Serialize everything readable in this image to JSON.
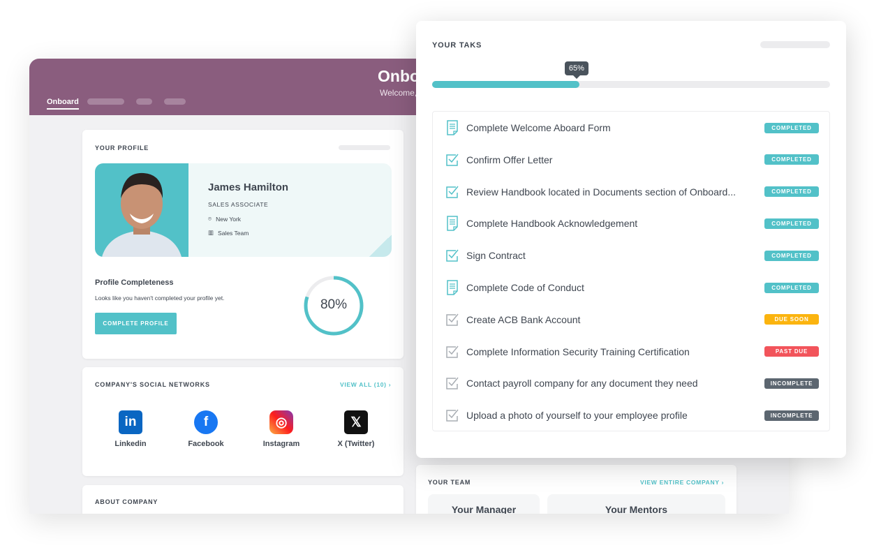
{
  "header": {
    "title": "Onboard",
    "subtitle": "Welcome,",
    "tabs": [
      {
        "label": "Onboard"
      }
    ]
  },
  "profile": {
    "section_title": "YOUR PROFILE",
    "name": "James Hamilton",
    "role": "SALES ASSOCIATE",
    "location": "New York",
    "team": "Sales Team",
    "completeness_title": "Profile Completeness",
    "completeness_text": "Looks like you haven't completed your profile yet.",
    "completeness_percent": "80%",
    "completeness_value": 80,
    "button": "COMPLETE PROFILE"
  },
  "social": {
    "section_title": "COMPANY'S SOCIAL NETWORKS",
    "view_all": "VIEW ALL (10)",
    "networks": [
      {
        "label": "Linkedin",
        "icon": "linkedin-icon",
        "color": "#0a66c2"
      },
      {
        "label": "Facebook",
        "icon": "facebook-icon",
        "color": "#1877f2"
      },
      {
        "label": "Instagram",
        "icon": "instagram-icon",
        "color": "#e1306c"
      },
      {
        "label": "X (Twitter)",
        "icon": "x-icon",
        "color": "#111111"
      }
    ]
  },
  "about": {
    "section_title": "ABOUT COMPANY"
  },
  "team": {
    "section_title": "YOUR TEAM",
    "view_link": "VIEW ENTIRE COMPANY",
    "manager": "Your Manager",
    "mentors": "Your Mentors"
  },
  "tasks": {
    "section_title": "YOUR TAKS",
    "progress_label": "65%",
    "progress_value": 37,
    "items": [
      {
        "label": "Complete Welcome Aboard Form",
        "icon": "document",
        "status": "COMPLETED",
        "color": "#52c1c8"
      },
      {
        "label": "Confirm Offer Letter",
        "icon": "checkbox",
        "status": "COMPLETED",
        "color": "#52c1c8"
      },
      {
        "label": "Review Handbook located in Documents section of Onboard...",
        "icon": "checkbox",
        "status": "COMPLETED",
        "color": "#52c1c8"
      },
      {
        "label": "Complete Handbook Acknowledgement",
        "icon": "document",
        "status": "COMPLETED",
        "color": "#52c1c8"
      },
      {
        "label": "Sign Contract",
        "icon": "checkbox",
        "status": "COMPLETED",
        "color": "#52c1c8"
      },
      {
        "label": "Complete Code of Conduct",
        "icon": "document",
        "status": "COMPLETED",
        "color": "#52c1c8"
      },
      {
        "label": "Create ACB Bank Account",
        "icon": "checkbox-gray",
        "status": "DUE SOON",
        "color": "#fbb40f"
      },
      {
        "label": "Complete Information Security Training Certification",
        "icon": "checkbox-gray",
        "status": "PAST DUE",
        "color": "#f2545b"
      },
      {
        "label": "Contact payroll company for any document they need",
        "icon": "checkbox-gray",
        "status": "INCOMPLETE",
        "color": "#5c6670"
      },
      {
        "label": "Upload a photo of yourself to your employee profile",
        "icon": "checkbox-gray",
        "status": "INCOMPLETE",
        "color": "#5c6670"
      }
    ]
  }
}
